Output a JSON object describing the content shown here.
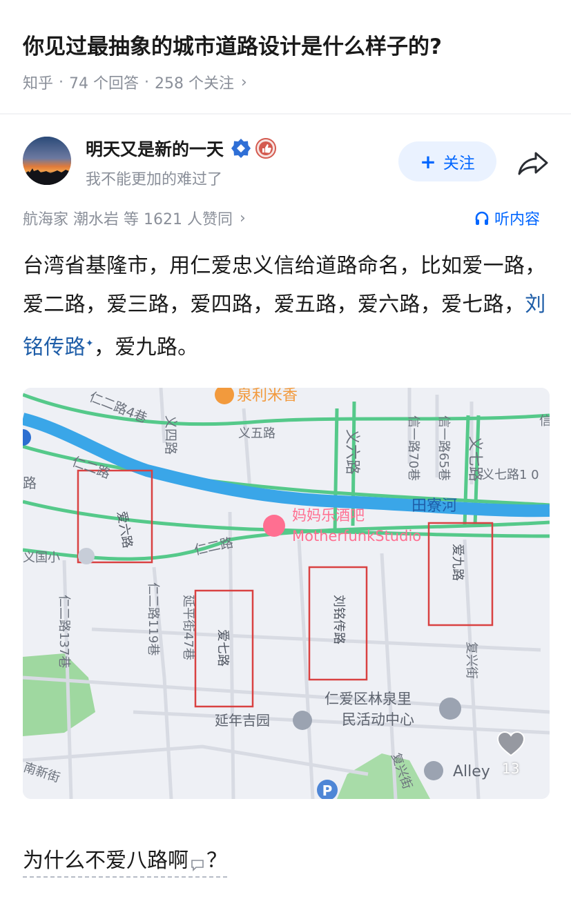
{
  "question": {
    "title": "你见过最抽象的城市道路设计是什么样子的?",
    "source": "知乎",
    "answers": "74 个回答",
    "followers": "258 个关注"
  },
  "author": {
    "name": "明天又是新的一天",
    "bio": "我不能更加的难过了",
    "follow_label": "关注"
  },
  "endorse": {
    "text": "航海家 潮水岩 等 1621 人赞同",
    "listen_label": "听内容"
  },
  "answer": {
    "part1": "台湾省基隆市，用仁爱忠义信给道路命名，比如爱一路，爱二路，爱三路，爱四路，爱五路，爱六路，爱七路，",
    "link": "刘铭传路",
    "part2": "，爱九路。"
  },
  "map": {
    "poi_rice": "泉利米香",
    "road_ren2_4": "仁二路4巷",
    "road_yi4": "义四路",
    "road_yi5": "义五路",
    "road_yi6": "义六路",
    "road_xin1_70": "信一路70巷",
    "road_xin1_65": "信一路65巷",
    "road_yi7": "义七路",
    "road_yi7_10": "义七路1 0",
    "road_xin": "信",
    "road_ren2_a": "仁二路",
    "river": "田寮河",
    "poi_bar_cn": "妈妈乐酒吧",
    "poi_bar_en": "MotherfunkStudio",
    "road_ren2_b": "仁二路",
    "school": "义国小",
    "road_ai6": "爱六路",
    "road_ai7": "爱七路",
    "road_liuming": "刘铭传路",
    "road_ai9": "爱九路",
    "road_ren2_119": "仁二路119巷",
    "road_yanping": "延平街47巷",
    "road_ren2_137": "仁二路137巷",
    "road_fuxing": "复兴街",
    "road_fuxing2": "复兴街",
    "poi_center_1": "仁爱区林泉里",
    "poi_center_2": "民活动中心",
    "poi_garden": "延年吉园",
    "road_nanxin": "南新街",
    "poi_alley": "Alley",
    "side_road": "路",
    "like_count": "13"
  },
  "comment": {
    "text": "为什么不爱八路啊",
    "suffix": "？"
  },
  "colors": {
    "accent": "#0066ff",
    "link": "#1f5ea8",
    "highlight_box": "#d94141",
    "river": "#3aa6e8",
    "green_road": "#55c98a",
    "poi_pink": "#ff6f91"
  }
}
